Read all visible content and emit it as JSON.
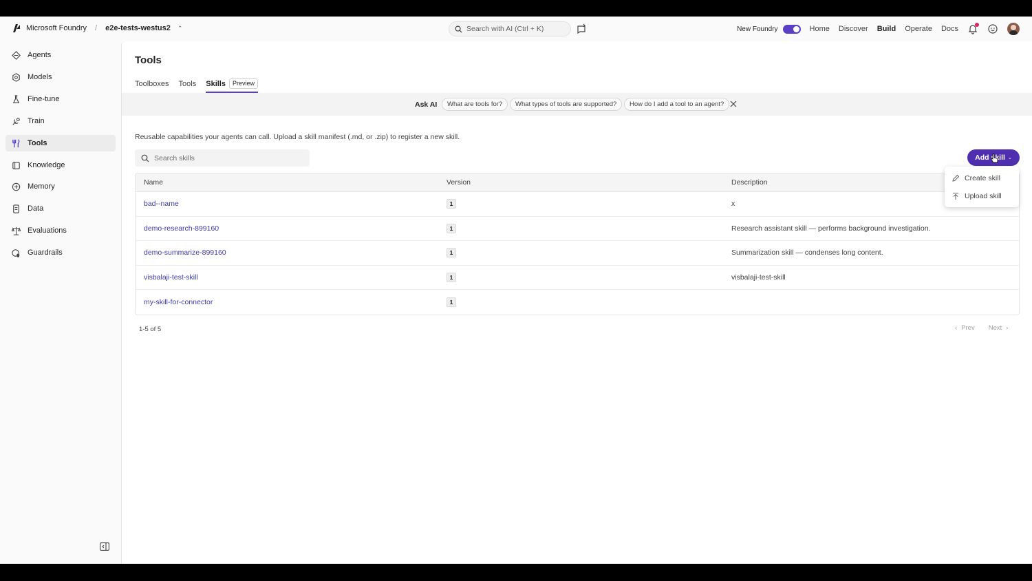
{
  "topbar": {
    "brand": "Microsoft Foundry",
    "separator": "/",
    "project": "e2e-tests-westus2",
    "search_placeholder": "Search with AI (Ctrl + K)",
    "new_foundry_label": "New Foundry",
    "nav": [
      "Home",
      "Discover",
      "Build",
      "Operate",
      "Docs"
    ],
    "active_nav": "Build"
  },
  "sidebar": {
    "items": [
      {
        "label": "Agents",
        "icon": "agents-icon"
      },
      {
        "label": "Models",
        "icon": "models-icon"
      },
      {
        "label": "Fine-tune",
        "icon": "flask-icon"
      },
      {
        "label": "Train",
        "icon": "train-icon"
      },
      {
        "label": "Tools",
        "icon": "tools-icon"
      },
      {
        "label": "Knowledge",
        "icon": "knowledge-icon"
      },
      {
        "label": "Memory",
        "icon": "memory-icon"
      },
      {
        "label": "Data",
        "icon": "data-icon"
      },
      {
        "label": "Evaluations",
        "icon": "scales-icon"
      },
      {
        "label": "Guardrails",
        "icon": "shield-icon"
      }
    ],
    "active": "Tools"
  },
  "page": {
    "title": "Tools",
    "tabs": [
      "Toolboxes",
      "Tools",
      "Skills"
    ],
    "active_tab": "Skills",
    "preview_badge": "Preview",
    "ask_ai": {
      "label": "Ask AI",
      "chips": [
        "What are tools for?",
        "What types of tools are supported?",
        "How do I add a tool to an agent?"
      ]
    },
    "description": "Reusable capabilities your agents can call. Upload a skill manifest (.md, or .zip) to register a new skill.",
    "search_placeholder": "Search skills",
    "add_button": "Add skill",
    "dropdown": [
      "Create skill",
      "Upload skill"
    ],
    "table": {
      "headers": [
        "Name",
        "Version",
        "Description"
      ],
      "rows": [
        {
          "name": "bad--name",
          "version": "1",
          "description": "x"
        },
        {
          "name": "demo-research-899160",
          "version": "1",
          "description": "Research assistant skill — performs background investigation."
        },
        {
          "name": "demo-summarize-899160",
          "version": "1",
          "description": "Summarization skill — condenses long content."
        },
        {
          "name": "visbalaji-test-skill",
          "version": "1",
          "description": "visbalaji-test-skill"
        },
        {
          "name": "my-skill-for-connector",
          "version": "1",
          "description": ""
        }
      ]
    },
    "pagination": {
      "count": "1-5 of 5",
      "prev": "Prev",
      "next": "Next"
    }
  },
  "colors": {
    "accent": "#4f2fb0",
    "link": "#3b3aa8",
    "toggle": "#5b3fc4"
  }
}
